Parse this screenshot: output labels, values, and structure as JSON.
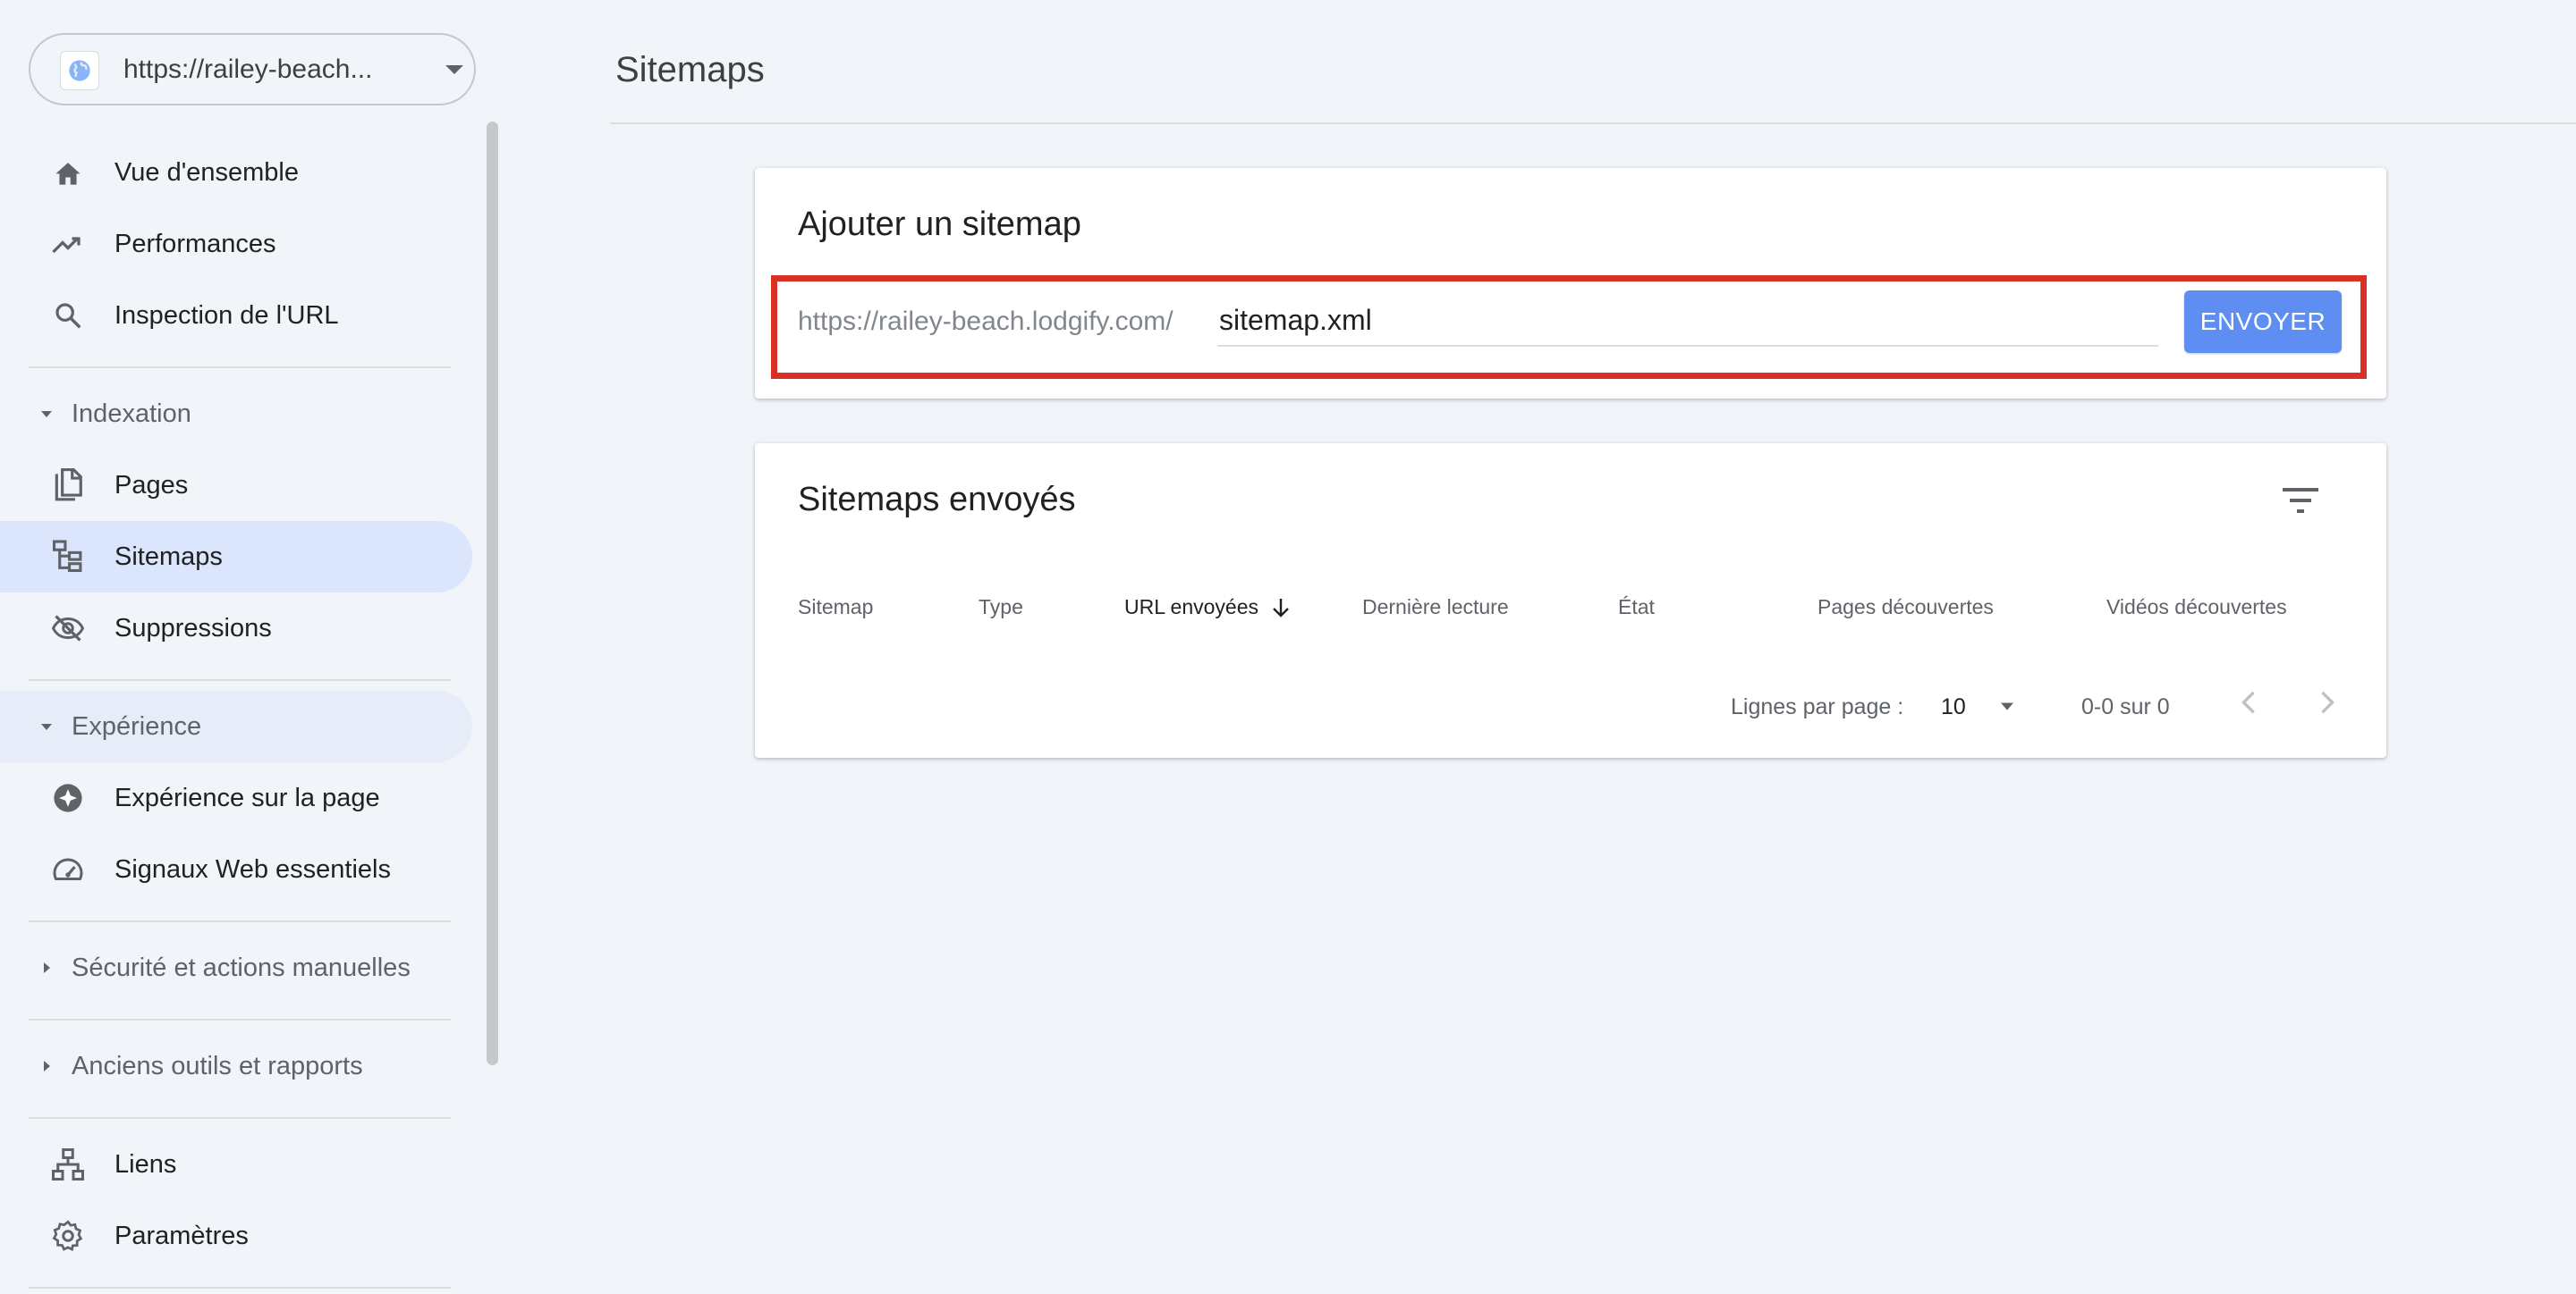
{
  "property": {
    "url": "https://railey-beach...",
    "icon": "globe-icon"
  },
  "sidebar": {
    "items_top": [
      {
        "label": "Vue d'ensemble",
        "icon": "home-icon"
      },
      {
        "label": "Performances",
        "icon": "trending-up-icon"
      },
      {
        "label": "Inspection de l'URL",
        "icon": "search-icon"
      }
    ],
    "sections": {
      "indexation": "Indexation",
      "experience": "Expérience",
      "security": "Sécurité et actions manuelles",
      "legacy": "Anciens outils et rapports"
    },
    "items_indexation": [
      {
        "label": "Pages",
        "icon": "pages-icon"
      },
      {
        "label": "Sitemaps",
        "icon": "sitemap-icon",
        "active": true
      },
      {
        "label": "Suppressions",
        "icon": "visibility-off-icon"
      }
    ],
    "items_experience": [
      {
        "label": "Expérience sur la page",
        "icon": "experience-icon"
      },
      {
        "label": "Signaux Web essentiels",
        "icon": "speed-icon"
      }
    ],
    "items_bottom": [
      {
        "label": "Liens",
        "icon": "links-icon"
      },
      {
        "label": "Paramètres",
        "icon": "settings-icon"
      }
    ]
  },
  "main": {
    "title": "Sitemaps",
    "add_card": {
      "title": "Ajouter un sitemap",
      "url_prefix": "https://railey-beach.lodgify.com/",
      "input_value": "sitemap.xml",
      "submit_label": "ENVOYER"
    },
    "sent_card": {
      "title": "Sitemaps envoyés",
      "columns": [
        "Sitemap",
        "Type",
        "URL envoyées",
        "Dernière lecture",
        "État",
        "Pages découvertes",
        "Vidéos découvertes"
      ],
      "sorted_column": "URL envoyées",
      "footer": {
        "rows_per_page_label": "Lignes par page :",
        "rows_per_page_value": "10",
        "range": "0-0 sur 0"
      }
    }
  },
  "colors": {
    "accent": "#5e8ef1",
    "highlight_border": "#d93025",
    "active_nav": "#dbe5fb",
    "background": "#f1f4f9"
  }
}
